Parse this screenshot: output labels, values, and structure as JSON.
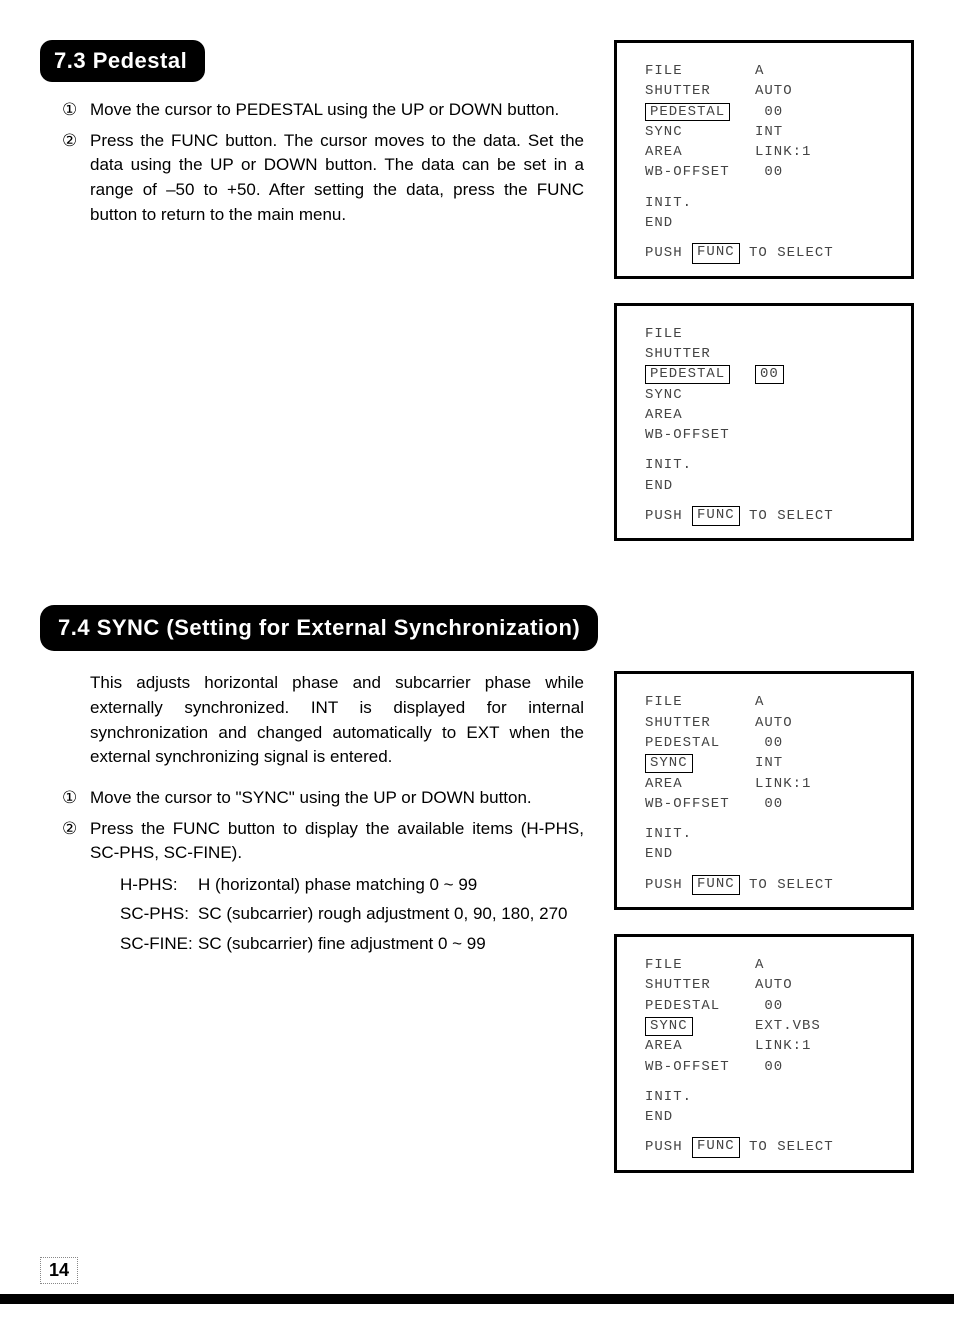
{
  "section73": {
    "header": "7.3  Pedestal",
    "steps": [
      "Move the cursor to PEDESTAL using the UP or DOWN button.",
      "Press the FUNC button. The cursor moves to the data. Set the data using the UP or DOWN button. The data can be set in a range of –50 to +50. After setting the data, press the FUNC button to return to the main menu."
    ]
  },
  "section74": {
    "header": "7.4  SYNC (Setting for External Synchronization)",
    "body": "This adjusts horizontal phase and subcarrier phase while externally synchronized. INT is displayed for internal synchronization and changed automatically to EXT when the external synchronizing signal is entered.",
    "steps": [
      "Move the cursor to \"SYNC\" using the UP or DOWN button.",
      "Press the FUNC button to display the available items (H-PHS, SC-PHS, SC-FINE)."
    ],
    "defs": [
      {
        "label": "H-PHS:",
        "val": "H (horizontal) phase matching 0 ~ 99"
      },
      {
        "label": "SC-PHS:",
        "val": "SC (subcarrier) rough adjustment 0, 90, 180, 270"
      },
      {
        "label": "SC-FINE:",
        "val": "SC (subcarrier) fine adjustment 0 ~ 99"
      }
    ]
  },
  "panels": {
    "common_labels": {
      "file": "FILE",
      "shutter": "SHUTTER",
      "pedestal": "PEDESTAL",
      "sync": "SYNC",
      "area": "AREA",
      "wboffset": "WB-OFFSET",
      "init": "INIT.",
      "end": "END",
      "push": "PUSH",
      "func": "FUNC",
      "to_select": "TO SELECT"
    },
    "p1": {
      "file": "A",
      "shutter": "AUTO",
      "pedestal": "00",
      "sync": "INT",
      "area": "LINK:1",
      "wboffset": "00"
    },
    "p2": {
      "pedestal": "00"
    },
    "p3": {
      "file": "A",
      "shutter": "AUTO",
      "pedestal": "00",
      "sync": "INT",
      "area": "LINK:1",
      "wboffset": "00"
    },
    "p4": {
      "file": "A",
      "shutter": "AUTO",
      "pedestal": "00",
      "sync": "EXT.VBS",
      "area": "LINK:1",
      "wboffset": "00"
    }
  },
  "page_number": "14",
  "markers": {
    "one": "①",
    "two": "②"
  }
}
